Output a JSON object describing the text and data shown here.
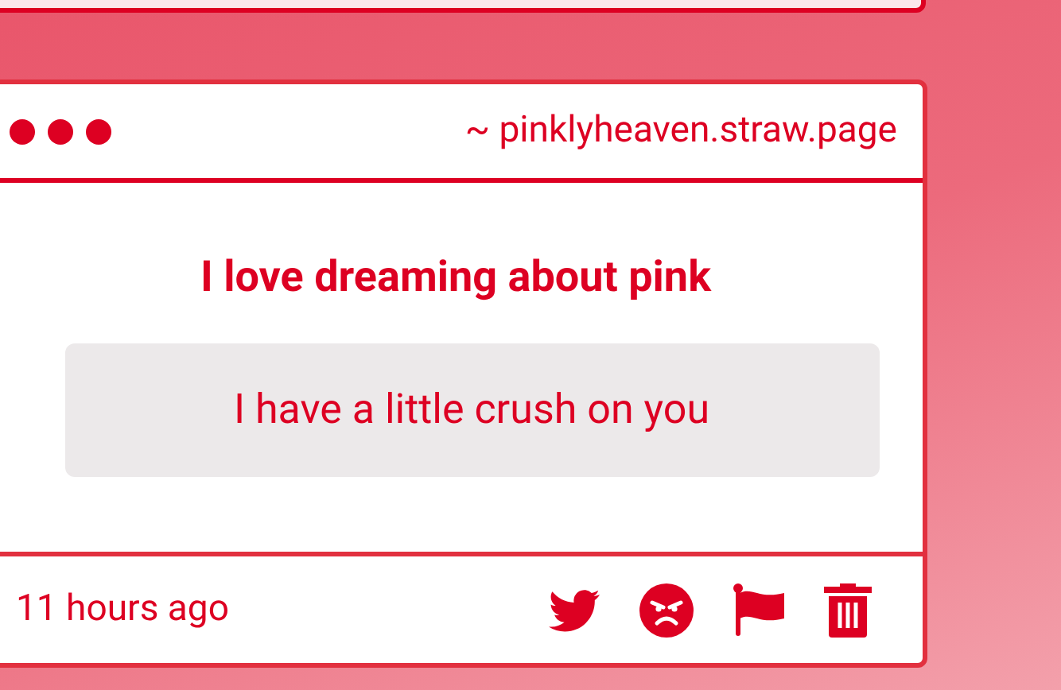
{
  "card": {
    "address": "~ pinklyheaven.straw.page",
    "title": "I love dreaming about pink",
    "message": "I have a little crush on you",
    "time": "11 hours ago"
  }
}
